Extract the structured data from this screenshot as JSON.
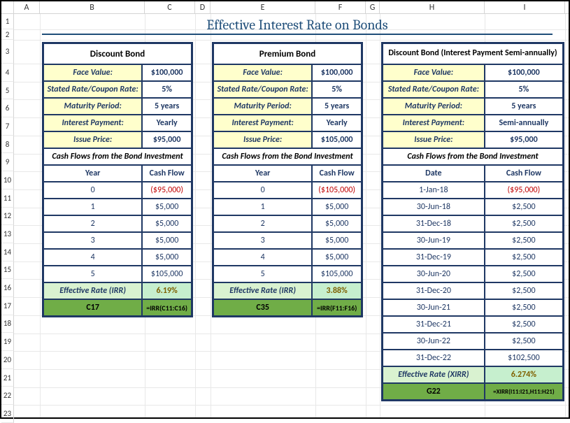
{
  "title": "Effective Interest Rate on Bonds",
  "columns": [
    "A",
    "B",
    "C",
    "D",
    "E",
    "F",
    "G",
    "H",
    "I"
  ],
  "rows": [
    "1",
    "2",
    "3",
    "4",
    "5",
    "6",
    "7",
    "8",
    "9",
    "10",
    "11",
    "12",
    "13",
    "14",
    "15",
    "16",
    "17",
    "18",
    "19",
    "20",
    "21",
    "22",
    "23"
  ],
  "labels": {
    "face": "Face Value:",
    "rate": "Stated Rate/Coupon Rate:",
    "maturity": "Maturity Period:",
    "payment": "Interest Payment:",
    "issue": "Issue Price:",
    "cashflows": "Cash Flows from the Bond Investment",
    "year": "Year",
    "date": "Date",
    "cashflow": "Cash Flow",
    "eff_irr": "Effective Rate (IRR)",
    "eff_xirr": "Effective Rate (XIRR)"
  },
  "discount": {
    "title": "Discount Bond",
    "face": "$100,000",
    "rate": "5%",
    "maturity": "5 years",
    "payment": "Yearly",
    "issue": "$95,000",
    "flows": [
      {
        "y": "0",
        "cf": "($95,000)",
        "neg": true
      },
      {
        "y": "1",
        "cf": "$5,000"
      },
      {
        "y": "2",
        "cf": "$5,000"
      },
      {
        "y": "3",
        "cf": "$5,000"
      },
      {
        "y": "4",
        "cf": "$5,000"
      },
      {
        "y": "5",
        "cf": "$105,000"
      }
    ],
    "eff": "6.19%",
    "ref": "C17",
    "formula": "=IRR(C11:C16)"
  },
  "premium": {
    "title": "Premium Bond",
    "face": "$100,000",
    "rate": "5%",
    "maturity": "5 years",
    "payment": "Yearly",
    "issue": "$105,000",
    "flows": [
      {
        "y": "0",
        "cf": "($105,000)",
        "neg": true
      },
      {
        "y": "1",
        "cf": "$5,000"
      },
      {
        "y": "2",
        "cf": "$5,000"
      },
      {
        "y": "3",
        "cf": "$5,000"
      },
      {
        "y": "4",
        "cf": "$5,000"
      },
      {
        "y": "5",
        "cf": "$105,000"
      }
    ],
    "eff": "3.88%",
    "ref": "C35",
    "formula": "=IRR(F11:F16)"
  },
  "semi": {
    "title": "Discount Bond (Interest Payment Semi-annually)",
    "face": "$100,000",
    "rate": "5%",
    "maturity": "5 years",
    "payment": "Semi-annually",
    "issue": "$95,000",
    "flows": [
      {
        "d": "1-Jan-18",
        "cf": "($95,000)",
        "neg": true
      },
      {
        "d": "30-Jun-18",
        "cf": "$2,500"
      },
      {
        "d": "31-Dec-18",
        "cf": "$2,500"
      },
      {
        "d": "30-Jun-19",
        "cf": "$2,500"
      },
      {
        "d": "31-Dec-19",
        "cf": "$2,500"
      },
      {
        "d": "30-Jun-20",
        "cf": "$2,500"
      },
      {
        "d": "31-Dec-20",
        "cf": "$2,500"
      },
      {
        "d": "30-Jun-21",
        "cf": "$2,500"
      },
      {
        "d": "31-Dec-21",
        "cf": "$2,500"
      },
      {
        "d": "30-Jun-22",
        "cf": "$2,500"
      },
      {
        "d": "31-Dec-22",
        "cf": "$102,500"
      }
    ],
    "eff": "6.274%",
    "ref": "G22",
    "formula": "=XIRR(I11:I21,H11:H21)"
  },
  "chart_data": [
    {
      "type": "table",
      "title": "Discount Bond",
      "columns": [
        "Year",
        "Cash Flow"
      ],
      "rows": [
        [
          "0",
          -95000
        ],
        [
          "1",
          5000
        ],
        [
          "2",
          5000
        ],
        [
          "3",
          5000
        ],
        [
          "4",
          5000
        ],
        [
          "5",
          105000
        ]
      ],
      "irr": 0.0619
    },
    {
      "type": "table",
      "title": "Premium Bond",
      "columns": [
        "Year",
        "Cash Flow"
      ],
      "rows": [
        [
          "0",
          -105000
        ],
        [
          "1",
          5000
        ],
        [
          "2",
          5000
        ],
        [
          "3",
          5000
        ],
        [
          "4",
          5000
        ],
        [
          "5",
          105000
        ]
      ],
      "irr": 0.0388
    },
    {
      "type": "table",
      "title": "Discount Bond (Interest Payment Semi-annually)",
      "columns": [
        "Date",
        "Cash Flow"
      ],
      "rows": [
        [
          "1-Jan-18",
          -95000
        ],
        [
          "30-Jun-18",
          2500
        ],
        [
          "31-Dec-18",
          2500
        ],
        [
          "30-Jun-19",
          2500
        ],
        [
          "31-Dec-19",
          2500
        ],
        [
          "30-Jun-20",
          2500
        ],
        [
          "31-Dec-20",
          2500
        ],
        [
          "30-Jun-21",
          2500
        ],
        [
          "31-Dec-21",
          2500
        ],
        [
          "30-Jun-22",
          2500
        ],
        [
          "31-Dec-22",
          102500
        ]
      ],
      "xirr": 0.06274
    }
  ]
}
